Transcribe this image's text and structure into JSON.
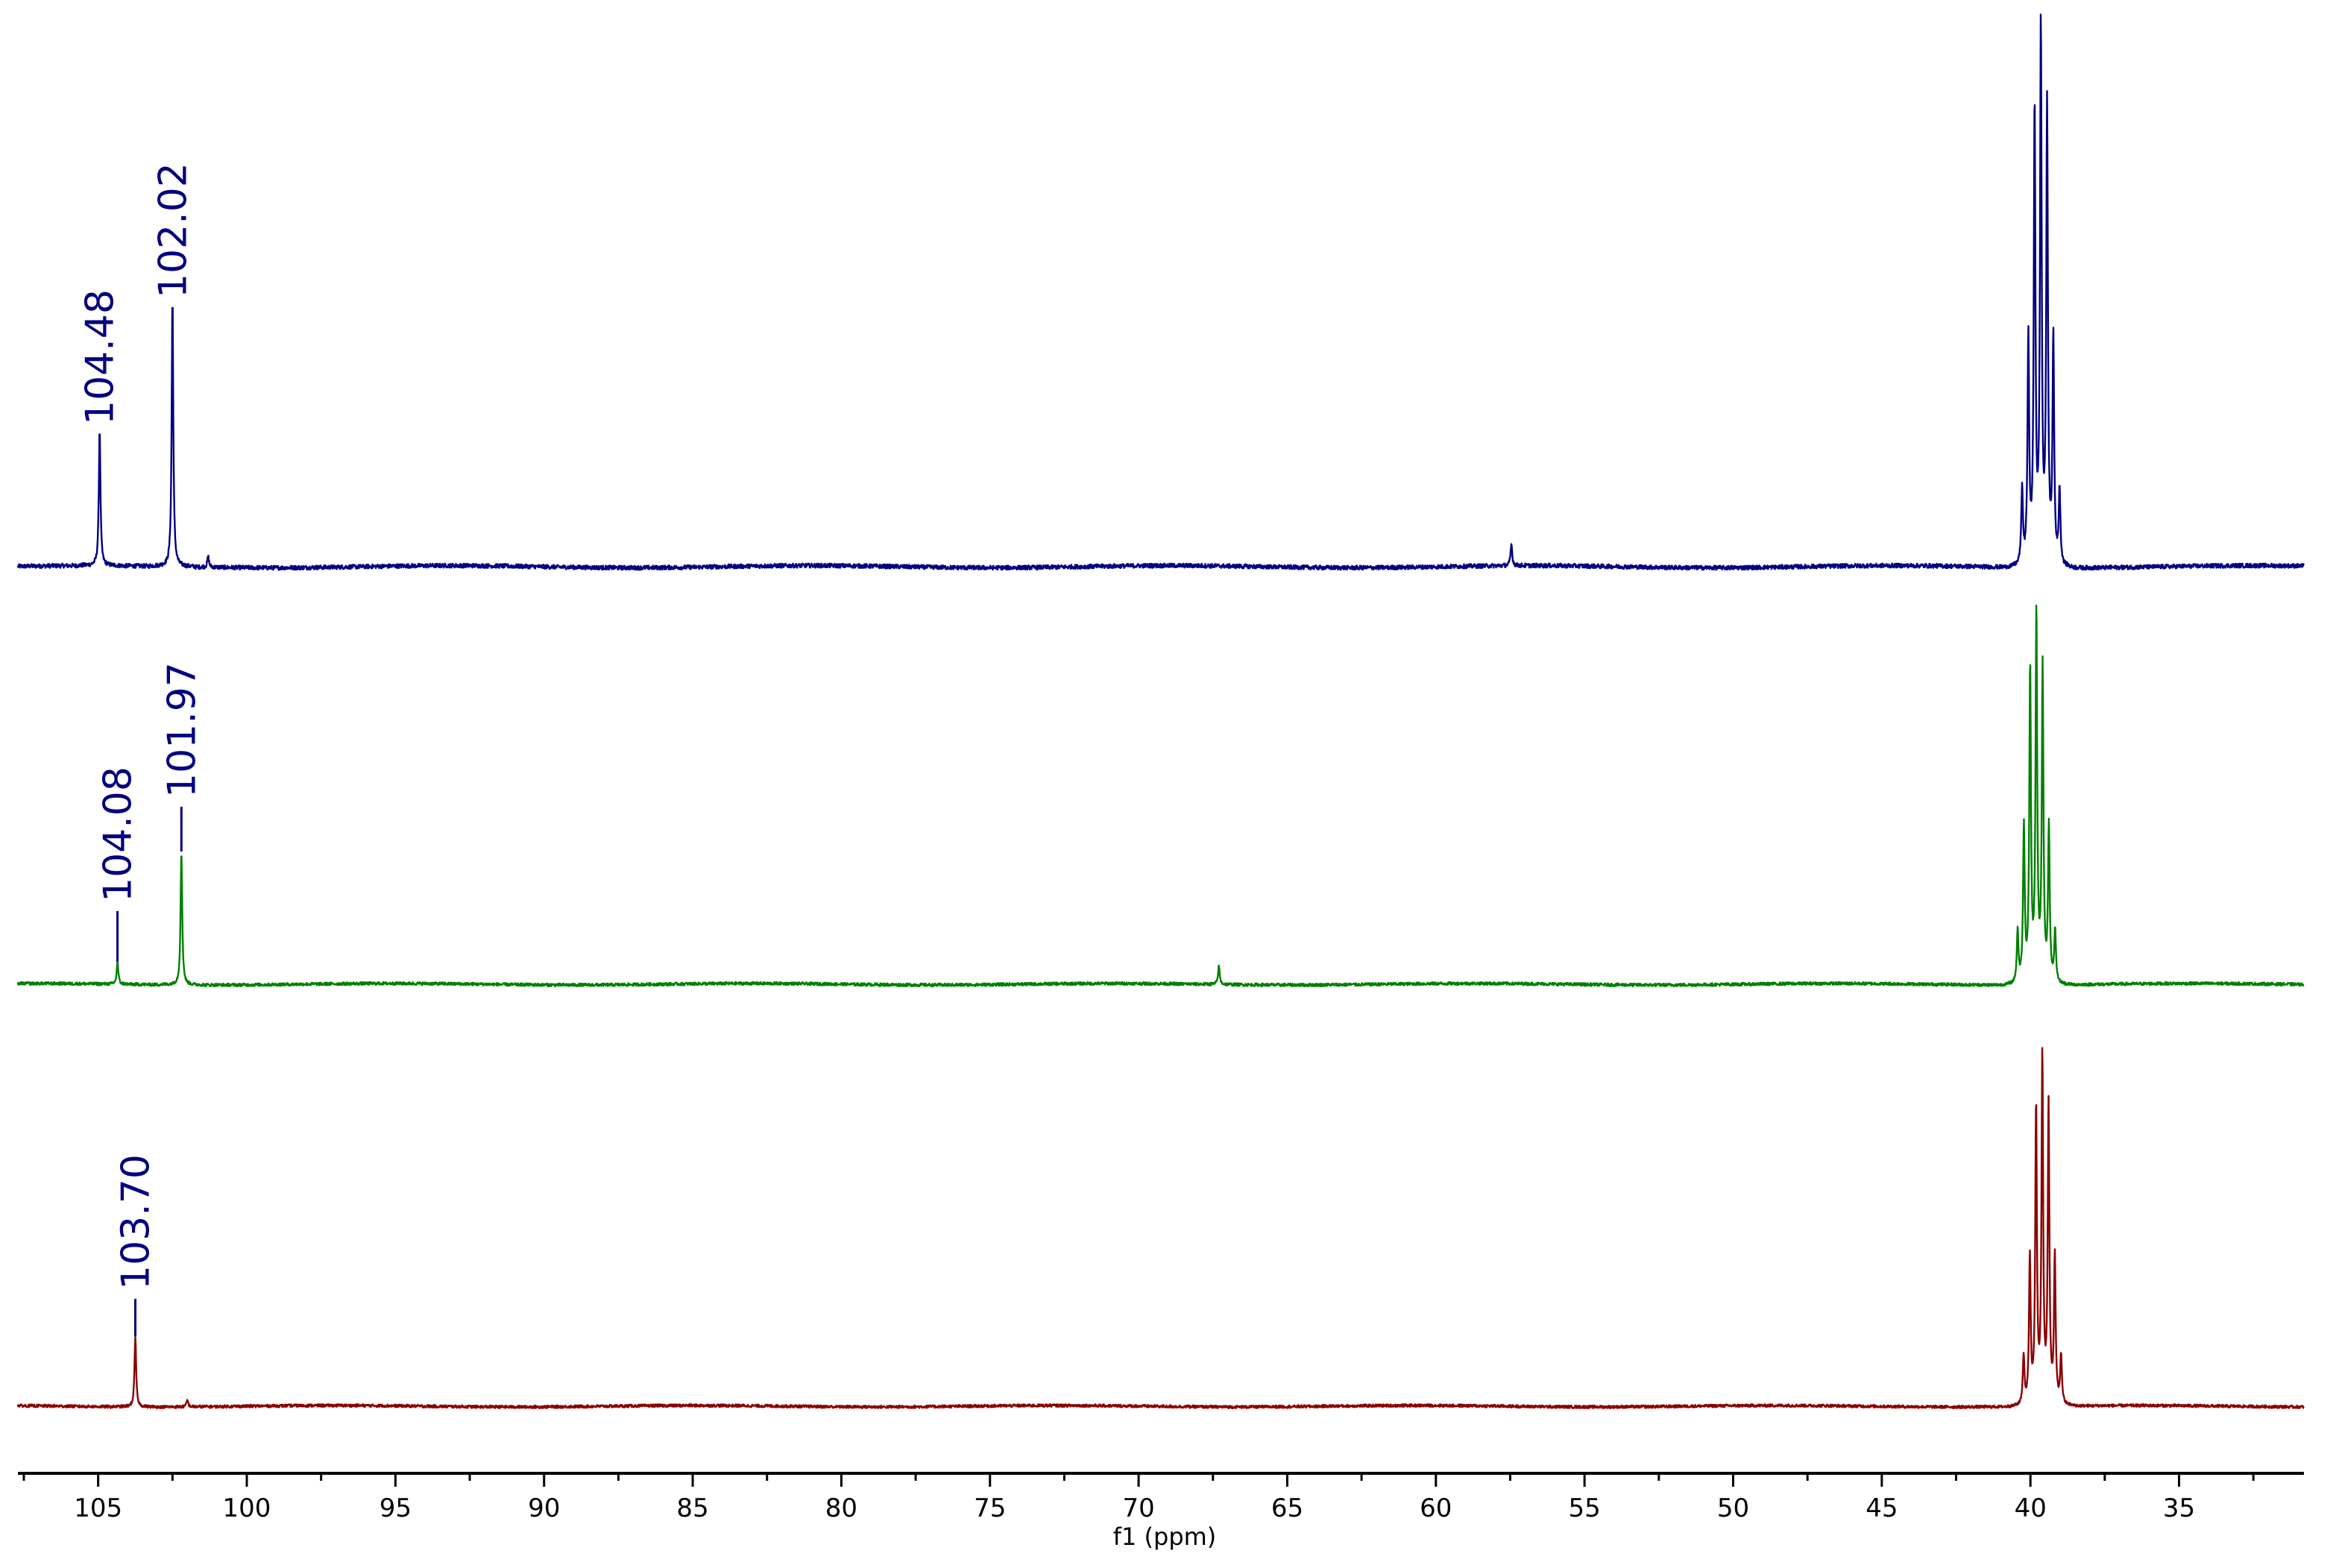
{
  "chart_data": {
    "type": "line",
    "title": "",
    "xlabel": "f1 (ppm)",
    "ylabel": "",
    "xlim": [
      107.7,
      30.8
    ],
    "x_ticks": [
      105,
      100,
      95,
      90,
      85,
      80,
      75,
      70,
      65,
      60,
      55,
      50,
      45,
      40,
      35
    ],
    "x_tick_labels": [
      "105",
      "100",
      "95",
      "90",
      "85",
      "80",
      "75",
      "70",
      "65",
      "60",
      "55",
      "50",
      "45",
      "40",
      "35"
    ],
    "minor_tick_step": 2.5,
    "grid": false,
    "label_color": "#000080",
    "series": [
      {
        "name": "spectrum-top",
        "color": "#000080",
        "solvent_multiplet_center": 39.65,
        "peaks": [
          {
            "ppm": 104.95,
            "height": 0.25,
            "label": "104.48"
          },
          {
            "ppm": 102.5,
            "height": 0.49,
            "label": "102.02"
          },
          {
            "ppm": 101.3,
            "height": 0.02
          },
          {
            "ppm": 57.46,
            "height": 0.04
          }
        ]
      },
      {
        "name": "spectrum-middle",
        "color": "#008000",
        "solvent_multiplet_center": 39.8,
        "peaks": [
          {
            "ppm": 104.35,
            "height": 0.06,
            "label": "104.08"
          },
          {
            "ppm": 102.2,
            "height": 0.36,
            "label": "101.97"
          },
          {
            "ppm": 67.3,
            "height": 0.05
          }
        ]
      },
      {
        "name": "spectrum-bottom",
        "color": "#8B0000",
        "solvent_multiplet_center": 39.6,
        "peaks": [
          {
            "ppm": 103.75,
            "height": 0.2,
            "label": "103.70"
          },
          {
            "ppm": 102.0,
            "height": 0.02
          }
        ]
      }
    ]
  }
}
